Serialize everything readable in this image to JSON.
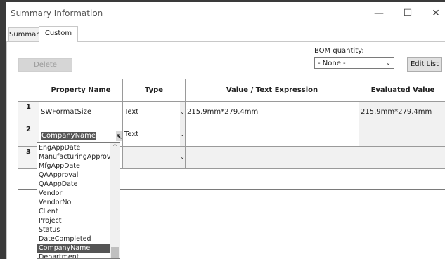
{
  "window": {
    "title": "Summary Information",
    "minimize": "—",
    "maximize": "☐",
    "close": "✕"
  },
  "tabs": [
    "Summary",
    "Custom"
  ],
  "toolbar": {
    "delete_label": "Delete",
    "bom_label": "BOM quantity:",
    "bom_value": "- None -",
    "edit_list_label": "Edit List"
  },
  "table": {
    "headers": [
      "Property Name",
      "Type",
      "Value / Text Expression",
      "Evaluated Value"
    ],
    "rows": [
      {
        "num": "1",
        "property": "SWFormatSize",
        "type": "Text",
        "value": "215.9mm*279.4mm",
        "evaluated": "215.9mm*279.4mm"
      },
      {
        "num": "2",
        "property": "CompanyName",
        "type": "Text",
        "value": "",
        "evaluated": ""
      },
      {
        "num": "3",
        "property": "",
        "type": "",
        "value": "",
        "evaluated": ""
      }
    ]
  },
  "dropdown": {
    "items": [
      "EngAppDate",
      "ManufacturingApproval",
      "MfgAppDate",
      "QAApproval",
      "QAAppDate",
      "Vendor",
      "VendorNo",
      "Client",
      "Project",
      "Status",
      "DateCompleted",
      "CompanyName",
      "Department"
    ],
    "selected": "CompanyName"
  }
}
